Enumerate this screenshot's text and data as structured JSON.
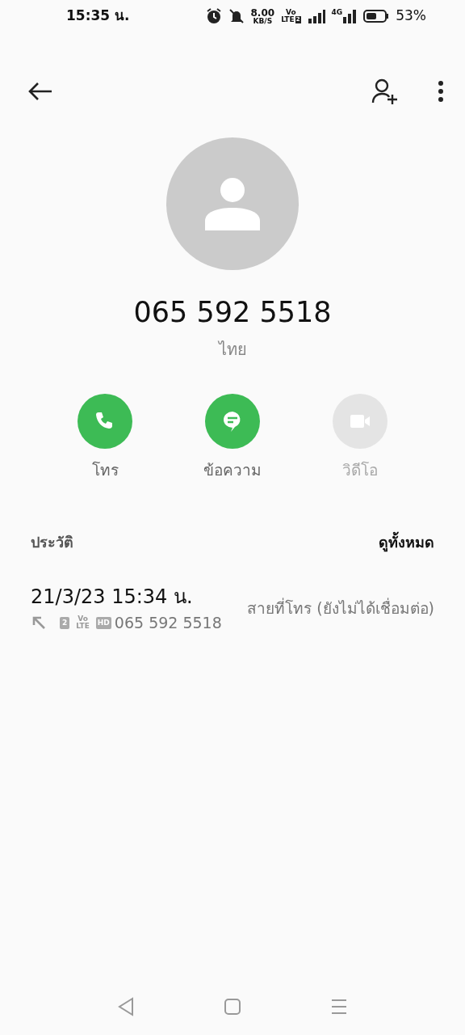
{
  "status_bar": {
    "time": "15:35 น.",
    "speed": "8.00",
    "speed_unit": "KB/S",
    "volte_top": "Vo",
    "volte_bottom": "LTE",
    "volte_sim": "2",
    "network": "4G",
    "battery": "53%"
  },
  "contact": {
    "number": "065 592 5518",
    "location": "ไทย"
  },
  "actions": [
    {
      "kind": "call",
      "label": "โทร",
      "disabled": false
    },
    {
      "kind": "message",
      "label": "ข้อความ",
      "disabled": false
    },
    {
      "kind": "video",
      "label": "วิดีโอ",
      "disabled": true
    }
  ],
  "history": {
    "title": "ประวัติ",
    "see_all": "ดูทั้งหมด",
    "entries": [
      {
        "datetime": "21/3/23 15:34 น.",
        "sim": "2",
        "volte_top": "Vo",
        "volte_bottom": "LTE",
        "hd": "HD",
        "number": "065 592 5518",
        "status": "สายที่โทร (ยังไม่ได้เชื่อมต่อ)"
      }
    ]
  }
}
